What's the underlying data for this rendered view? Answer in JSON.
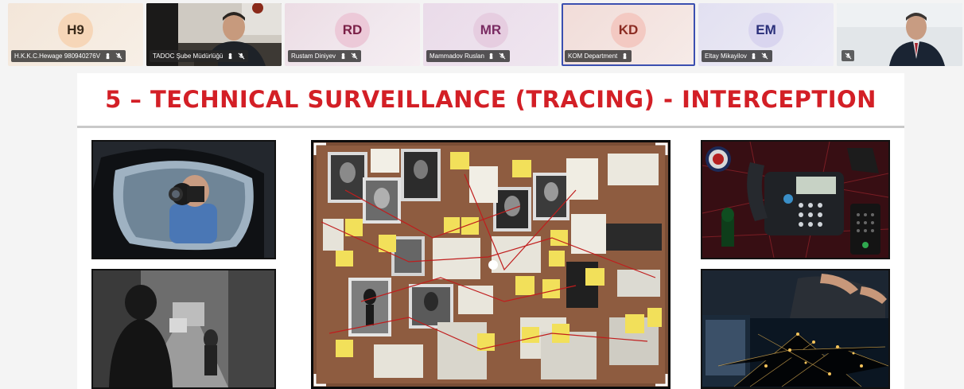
{
  "participants": [
    {
      "initials": "H9",
      "name": "H.K.K.C.Hewage 980940276V",
      "bg": "#f6d6b8",
      "fg": "#3a2a1a"
    },
    {
      "name": "TADOC Şube Müdürlüğü"
    },
    {
      "initials": "RD",
      "name": "Rustam Diniyev",
      "bg": "#ecc9d8",
      "fg": "#7a1f46"
    },
    {
      "initials": "MR",
      "name": "Mammadov Ruslan",
      "bg": "#e6cde0",
      "fg": "#7a2b62"
    },
    {
      "initials": "KD",
      "name": "KOM Department",
      "bg": "#f3c9c2",
      "fg": "#8b2b22"
    },
    {
      "initials": "EM",
      "name": "Eltay Mikayilov",
      "bg": "#d9d5ef",
      "fg": "#2a2f7a"
    }
  ],
  "slide": {
    "title": "5 – TECHNICAL SURVEILLANCE (TRACING) - INTERCEPTION",
    "title_color": "#d31f26"
  }
}
